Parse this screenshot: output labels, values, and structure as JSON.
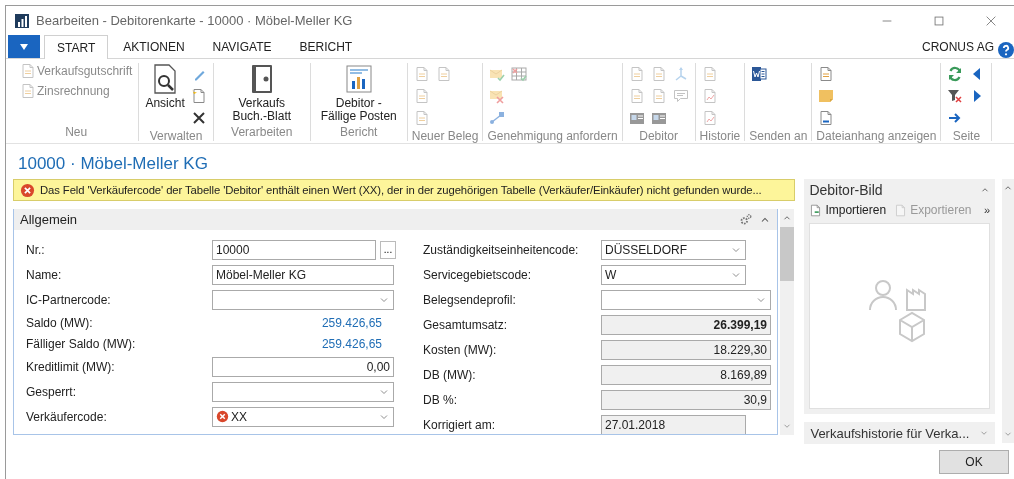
{
  "window": {
    "title": "Bearbeiten - Debitorenkarte - 10000 · Möbel-Meller KG"
  },
  "ribbon": {
    "tabs": [
      {
        "label": "START",
        "selected": true
      },
      {
        "label": "AKTIONEN",
        "selected": false
      },
      {
        "label": "NAVIGATE",
        "selected": false
      },
      {
        "label": "BERICHT",
        "selected": false
      }
    ],
    "company": "CRONUS AG",
    "groups": [
      {
        "label": "Neu",
        "disabled": true,
        "items": [
          {
            "kind": "text_button",
            "label": "Verkaufsgutschrift"
          },
          {
            "kind": "text_button",
            "label": "Zinsrechnung"
          }
        ]
      },
      {
        "label": "Verwalten",
        "disabled": false,
        "items": [
          {
            "kind": "view",
            "label": "Ansicht"
          },
          {
            "kind": "pencil"
          },
          {
            "kind": "new_doc"
          },
          {
            "kind": "delete"
          }
        ]
      },
      {
        "label": "Verarbeiten",
        "disabled": false,
        "items": [
          {
            "kind": "journal",
            "label": "Verkaufs Buch.-Blatt"
          }
        ]
      },
      {
        "label": "Bericht",
        "disabled": false,
        "items": [
          {
            "kind": "report",
            "label": "Debitor - Fällige Posten"
          }
        ]
      },
      {
        "label": "Neuer Beleg",
        "disabled": true,
        "items": [
          {
            "kind": "doc"
          },
          {
            "kind": "doc"
          },
          {
            "kind": "doc"
          },
          {
            "kind": "doc"
          }
        ]
      },
      {
        "label": "Genehmigung anfordern",
        "disabled": true,
        "items": [
          {
            "kind": "mail_check"
          },
          {
            "kind": "mail_cancel"
          },
          {
            "kind": "flow"
          },
          {
            "kind": "calendar"
          }
        ]
      },
      {
        "label": "Debitor",
        "disabled": true,
        "items": [
          {
            "kind": "doc"
          },
          {
            "kind": "doc"
          },
          {
            "kind": "card"
          },
          {
            "kind": "doc"
          },
          {
            "kind": "doc"
          },
          {
            "kind": "card"
          },
          {
            "kind": "arrows"
          },
          {
            "kind": "comment"
          }
        ]
      },
      {
        "label": "Historie",
        "disabled": true,
        "items": [
          {
            "kind": "doc"
          },
          {
            "kind": "chart_doc"
          },
          {
            "kind": "chart_doc"
          }
        ]
      },
      {
        "label": "Senden an",
        "disabled": false,
        "items": [
          {
            "kind": "word"
          }
        ]
      },
      {
        "label": "Dateianhang anzeigen",
        "disabled": false,
        "items": [
          {
            "kind": "doc"
          },
          {
            "kind": "note"
          },
          {
            "kind": "link_doc"
          }
        ]
      },
      {
        "label": "Seite",
        "disabled": false,
        "items": [
          {
            "kind": "refresh"
          },
          {
            "kind": "clear_filter"
          },
          {
            "kind": "arrow"
          },
          {
            "kind": "previous"
          },
          {
            "kind": "next"
          }
        ]
      }
    ]
  },
  "page_title": "10000 · Möbel-Meller KG",
  "error_bar": {
    "message": "Das Feld 'Verkäufercode' der Tabelle 'Debitor' enthält einen Wert (XX), der in der zugehörigen Tabelle (Verkäufer/Einkäufer) nicht gefunden wurde..."
  },
  "general": {
    "title": "Allgemein",
    "left_fields": [
      {
        "label": "Nr.:",
        "kind": "lookup",
        "value": "10000",
        "lookup_button": "..."
      },
      {
        "label": "Name:",
        "kind": "text",
        "value": "Möbel-Meller KG"
      },
      {
        "label": "IC-Partnercode:",
        "kind": "dropdown"
      },
      {
        "label": "Saldo (MW):",
        "kind": "link",
        "value": "259.426,65"
      },
      {
        "label": "Fälliger Saldo (MW):",
        "kind": "link",
        "value": "259.426,65"
      },
      {
        "label": "Kreditlimit (MW):",
        "kind": "number",
        "value": "0,00"
      },
      {
        "label": "Gesperrt:",
        "kind": "dropdown"
      },
      {
        "label": "Verkäufercode:",
        "kind": "dropdown",
        "value": "XX",
        "error": true
      }
    ],
    "right_fields": [
      {
        "label": "Zuständigkeitseinheitencode:",
        "kind": "short_dropdown",
        "value": "DÜSSELDORF"
      },
      {
        "label": "Servicegebietscode:",
        "kind": "short_dropdown",
        "value": "W"
      },
      {
        "label": "Belegsendeprofil:",
        "kind": "dropdown"
      },
      {
        "label": "Gesamtumsatz:",
        "kind": "readonly",
        "value": "26.399,19",
        "emphasis": true
      },
      {
        "label": "Kosten (MW):",
        "kind": "readonly",
        "value": "18.229,30",
        "emphasis": false
      },
      {
        "label": "DB (MW):",
        "kind": "readonly",
        "value": "8.169,89",
        "emphasis": false
      },
      {
        "label": "DB %:",
        "kind": "readonly",
        "value": "30,9",
        "emphasis": false
      },
      {
        "label": "Korrigiert am:",
        "kind": "date",
        "value": "27.01.2018"
      }
    ]
  },
  "factbox": {
    "title": "Debitor-Bild",
    "actions": [
      {
        "label": "Importieren",
        "disabled": false
      },
      {
        "label": "Exportieren",
        "disabled": true
      }
    ],
    "more": "»",
    "collapsed_part": {
      "title": "Verkaufshistorie für Verka...",
      "expanded": false
    }
  },
  "buttons": [
    "OK"
  ]
}
